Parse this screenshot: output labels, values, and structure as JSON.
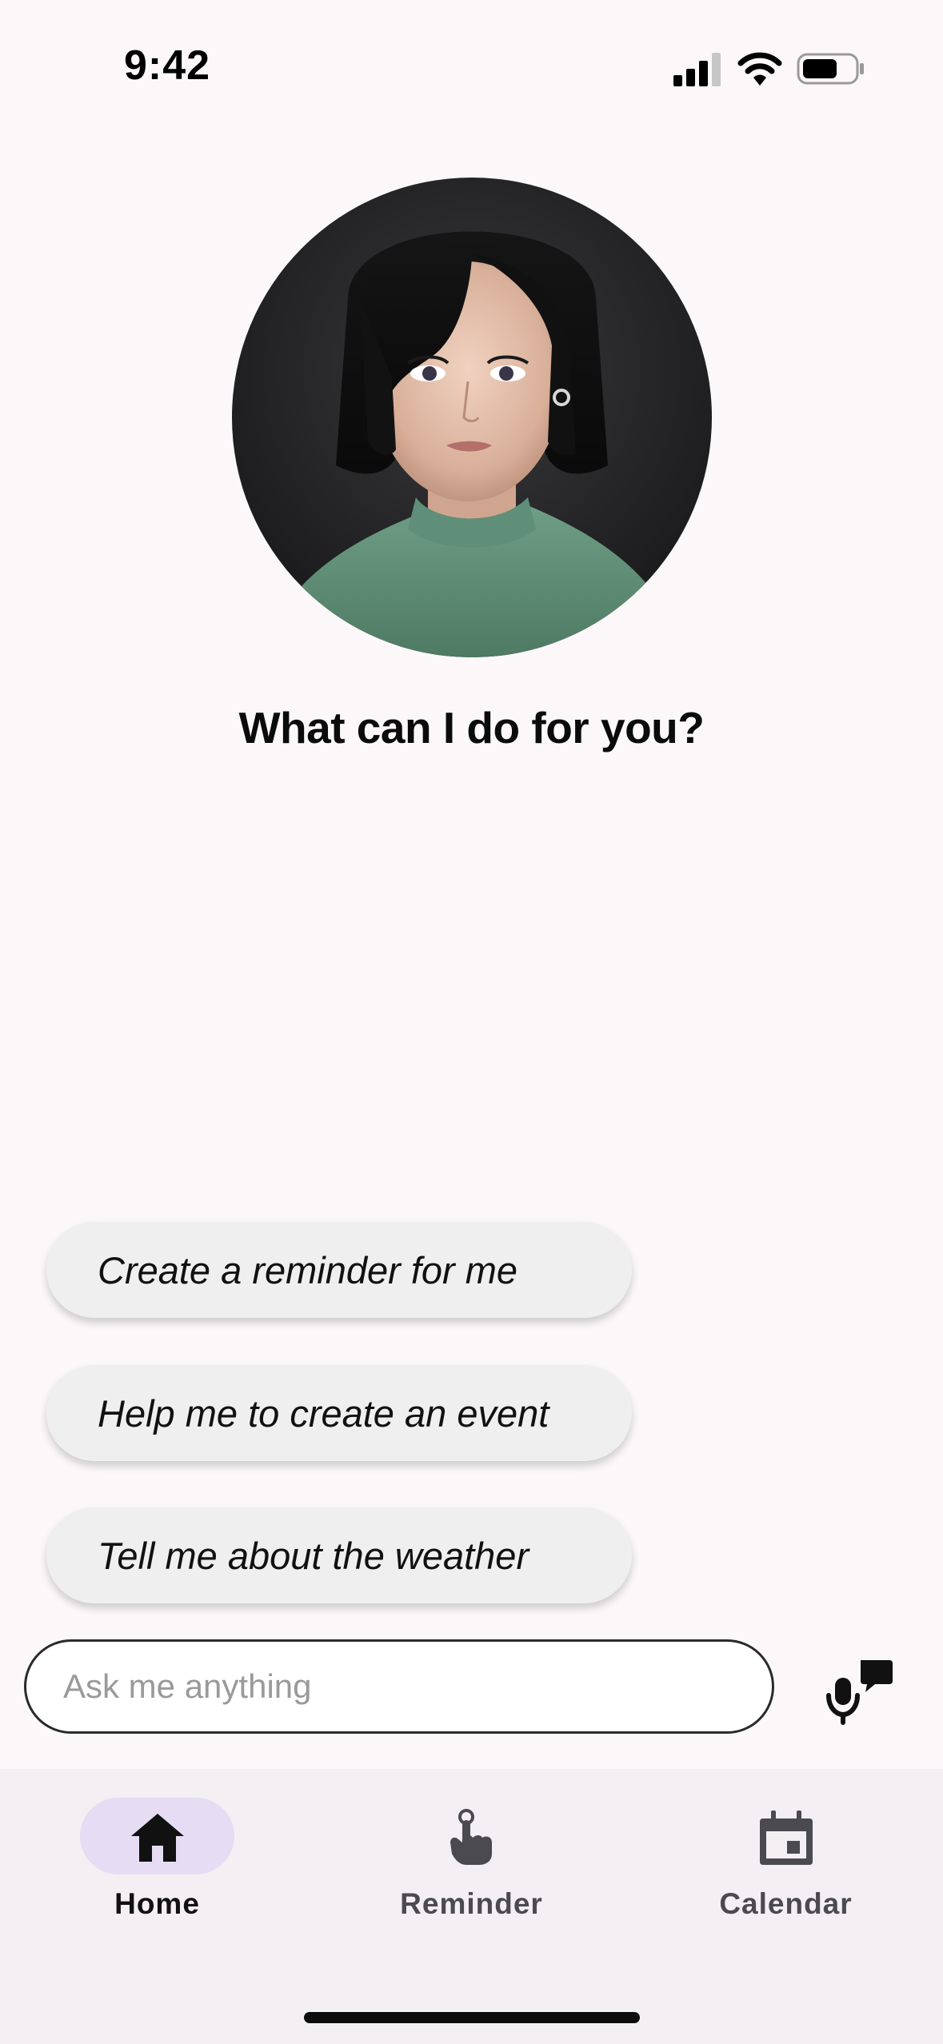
{
  "status_bar": {
    "time": "9:42",
    "signal_icon": "cellular-signal-icon",
    "wifi_icon": "wifi-icon",
    "battery_icon": "battery-icon"
  },
  "assistant": {
    "avatar_icon": "assistant-avatar",
    "greeting": "What can I do for you?"
  },
  "suggestions": [
    "Create a reminder for me",
    "Help me to create an event",
    "Tell me about the weather"
  ],
  "input": {
    "placeholder": "Ask me anything",
    "value": ""
  },
  "voice_button": {
    "icon": "voice-chat-icon"
  },
  "nav": {
    "items": [
      {
        "label": "Home",
        "icon": "home-icon",
        "active": true
      },
      {
        "label": "Reminder",
        "icon": "reminder-finger-icon",
        "active": false
      },
      {
        "label": "Calendar",
        "icon": "calendar-icon",
        "active": false
      }
    ],
    "active_pill_color": "#e6dcf3"
  },
  "colors": {
    "background": "#fcf8fa",
    "suggestion_bg": "#efeff0",
    "nav_bg": "#f4eff3"
  }
}
